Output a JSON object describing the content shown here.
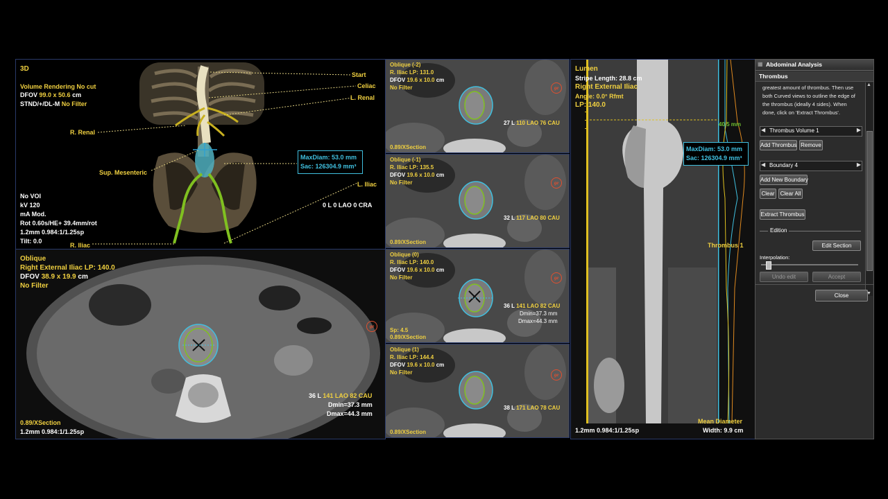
{
  "vr3d": {
    "label": "3D",
    "line1": "Volume Rendering No cut",
    "line2a": "DFOV ",
    "line2b": "99.0 x 50.6",
    "line2c": " cm",
    "line3a": "STND/+/DL-M ",
    "line3b": "No Filter",
    "maxdiam": "MaxDiam: 53.0 mm",
    "sac": "Sac: 126304.9 mm³",
    "labels": {
      "start": "Start",
      "celiac": "Celiac",
      "lrenal": "L. Renal",
      "rrenal": "R. Renal",
      "supmes": "Sup. Mesenteric",
      "liliac": "L. Iliac",
      "riliac": "R. Iliac"
    },
    "orient": "0 L 0 LAO 0 CRA",
    "info": [
      "No VOI",
      "kV 120",
      "mA Mod.",
      "Rot 0.60s/HE+ 39.4mm/rot",
      "1.2mm 0.984:1/1.25sp",
      "Tilt: 0.0"
    ]
  },
  "axial": {
    "title": "Oblique",
    "line2": "Right External Iliac LP: 140.0",
    "line3a": "DFOV ",
    "line3b": "38.9 x 19.9",
    "line3c": " cm",
    "line4": "No Filter",
    "orient_a": "36 L ",
    "orient_b": "141 LAO 82 CAU",
    "dmin": "Dmin=37.3 mm",
    "dmax": "Dmax=44.3 mm",
    "xsec": "0.89/XSection",
    "bottom": "1.2mm 0.984:1/1.25sp",
    "logo": "ge"
  },
  "obliques": [
    {
      "title": "Oblique (-2)",
      "lp": "R. Iliac LP: 131.0",
      "dfov_a": "DFOV ",
      "dfov_b": "19.6 x 10.0",
      "dfov_c": " cm",
      "filter": "No Filter",
      "orient_a": "27 L ",
      "orient_b": "110 LAO 76 CAU",
      "xsec": "0.89/XSection",
      "extra1": "",
      "extra2": "",
      "sp": ""
    },
    {
      "title": "Oblique (-1)",
      "lp": "R. Iliac LP: 135.5",
      "dfov_a": "DFOV ",
      "dfov_b": "19.6 x 10.0",
      "dfov_c": " cm",
      "filter": "No Filter",
      "orient_a": "32 L ",
      "orient_b": "117 LAO 80 CAU",
      "xsec": "0.89/XSection",
      "extra1": "",
      "extra2": "",
      "sp": ""
    },
    {
      "title": "Oblique (0)",
      "lp": "R. Iliac LP: 140.0",
      "dfov_a": "DFOV ",
      "dfov_b": "19.6 x 10.0",
      "dfov_c": " cm",
      "filter": "No Filter",
      "orient_a": "36 L ",
      "orient_b": "141 LAO 82 CAU",
      "xsec": "0.89/XSection",
      "extra1": "Dmin=37.3 mm",
      "extra2": "Dmax=44.3 mm",
      "sp": "Sp: 4.5"
    },
    {
      "title": "Oblique (1)",
      "lp": "R. Iliac LP: 144.4",
      "dfov_a": "DFOV ",
      "dfov_b": "19.6 x 10.0",
      "dfov_c": " cm",
      "filter": "No Filter",
      "orient_a": "38 L ",
      "orient_b": "171 LAO 78 CAU",
      "xsec": "0.89/XSection",
      "extra1": "",
      "extra2": "",
      "sp": ""
    }
  ],
  "lumen": {
    "title": "Lumen",
    "stripe": "Stripe Length: 28.8 cm",
    "vessel": "Right External Iliac",
    "angle": "Angle: 0.0° Rfmt",
    "lp": "LP: 140.0",
    "measure": "40.5 mm",
    "maxdiam": "MaxDiam: 53.0 mm",
    "sac": "Sac: 126304.9 mm³",
    "thrombus": "Thrombus 1",
    "mean": "Mean Diameter",
    "width": "Width: 9.9 cm",
    "bottom": "1.2mm 0.984:1/1.25sp"
  },
  "panel": {
    "title": "Abdominal Analysis",
    "section": "Thrombus",
    "instructions": [
      "greatest amount of thrombus. Then use",
      "both Curved views to outline the edge of",
      "the thrombus (ideally 4 sides). When",
      "done, click on 'Extract Thrombus'."
    ],
    "volume_select": "Thrombus Volume 1",
    "add_thrombus": "Add Thrombus",
    "remove": "Remove",
    "boundary_select": "Boundary 4",
    "add_boundary": "Add New Boundary",
    "clear": "Clear",
    "clear_all": "Clear All",
    "extract": "Extract Thrombus",
    "edition": "Edition",
    "edit_section": "Edit Section",
    "interpolation": "Interpolation:",
    "interpolation_value": 0.05,
    "undo": "Undo edit",
    "accept": "Accept",
    "close": "Close"
  },
  "colors": {
    "yellow": "#f0d040",
    "cyan": "#40c0e0",
    "green": "#70c030",
    "orange": "#e08a20"
  }
}
